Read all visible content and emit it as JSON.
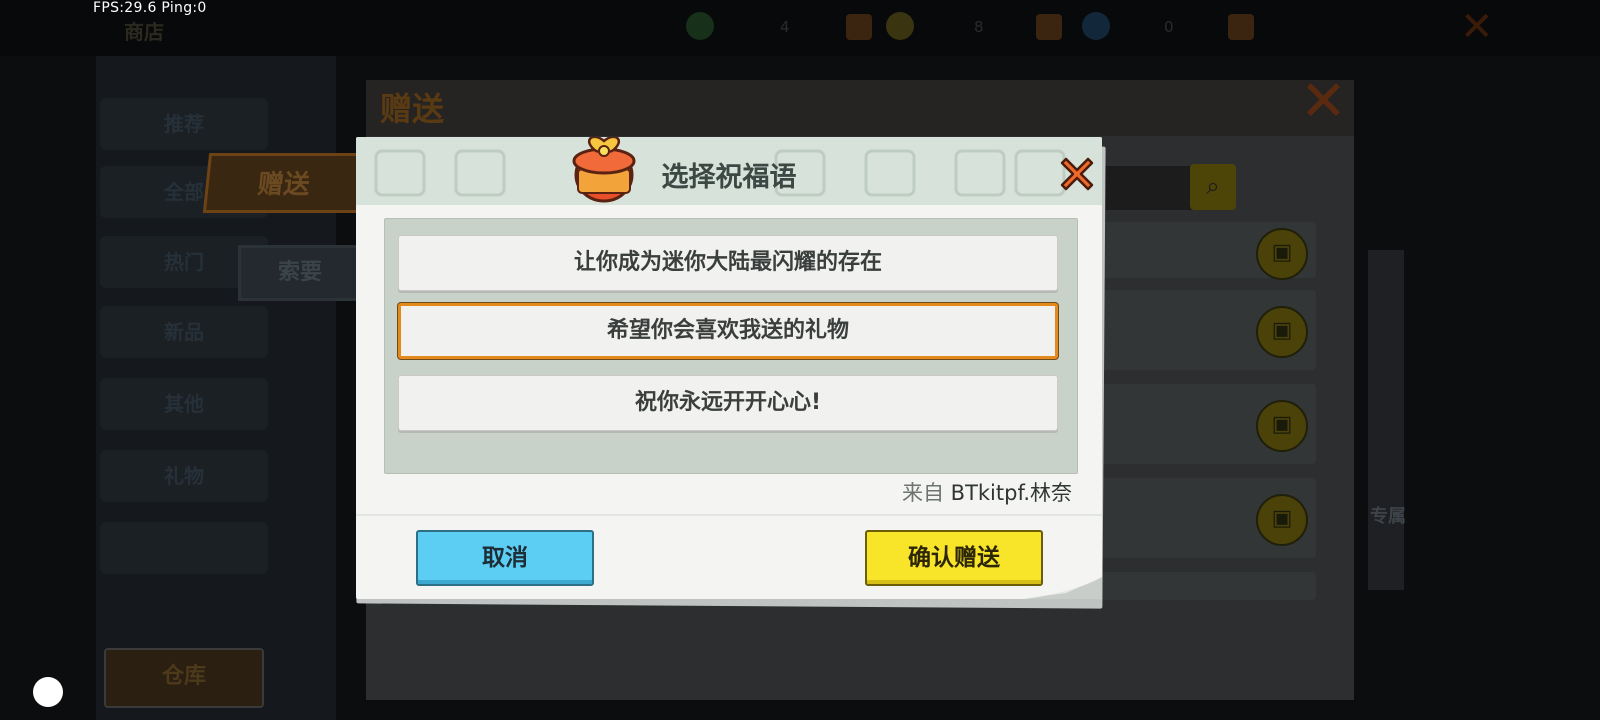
{
  "hud": {
    "fps_text": "FPS:29.6  Ping:0",
    "top_left_label": "商店",
    "currencies": [
      {
        "icon": "mini-bean-icon",
        "value": "4"
      },
      {
        "icon": "mini-coin-icon",
        "value": "8"
      },
      {
        "icon": "mini-point-icon",
        "value": "0"
      }
    ]
  },
  "background": {
    "side_menu": [
      "推荐",
      "全部",
      "热门",
      "新品",
      "其他",
      "礼物"
    ],
    "tab_give": "赠送",
    "tab_ask": "索要",
    "panel_title": "赠送",
    "bottom_button": "仓库",
    "side_label": "专属"
  },
  "dialog": {
    "title": "选择祝福语",
    "wishes": [
      "让你成为迷你大陆最闪耀的存在",
      "希望你会喜欢我送的礼物",
      "祝你永远开开心心!"
    ],
    "selected_index": 1,
    "from_prefix": "来自",
    "from_name": "BTkitpf.林奈",
    "cancel_label": "取消",
    "confirm_label": "确认赠送"
  },
  "colors": {
    "accent_orange": "#e38a1d",
    "cancel_blue": "#5ccdf3",
    "confirm_yellow": "#f8e52a",
    "header_green": "#d6e2da"
  }
}
